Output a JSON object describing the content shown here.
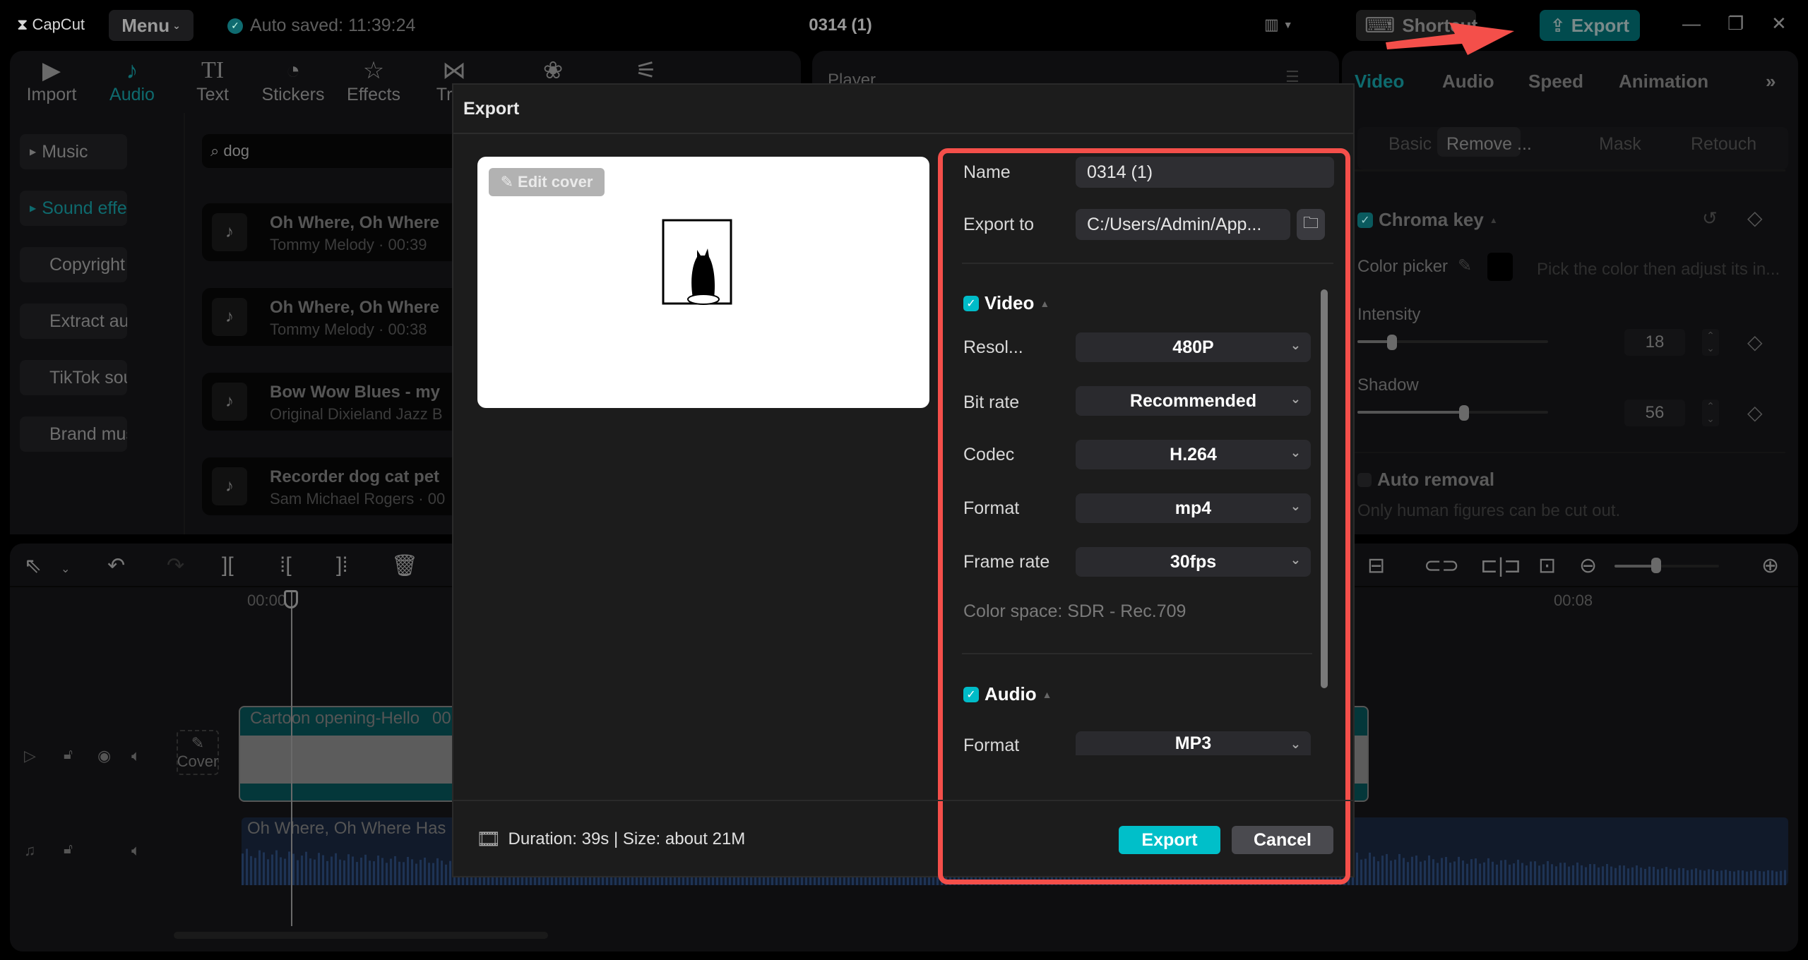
{
  "app": {
    "logo": "CapCut",
    "menu_label": "Menu",
    "autosave": "Auto saved: 11:39:24",
    "title": "0314 (1)",
    "shortcut_label": "Shortcut",
    "export_label": "Export"
  },
  "media_toolbar": [
    {
      "label": "Import",
      "icon": "import-icon"
    },
    {
      "label": "Audio",
      "icon": "audio-icon",
      "active": true
    },
    {
      "label": "Text",
      "icon": "text-icon"
    },
    {
      "label": "Stickers",
      "icon": "stickers-icon"
    },
    {
      "label": "Effects",
      "icon": "effects-icon"
    },
    {
      "label": "Tran",
      "icon": "transitions-icon"
    },
    {
      "label": "",
      "icon": "filters-icon"
    },
    {
      "label": "",
      "icon": "adjustment-icon"
    }
  ],
  "audio_sidebar": [
    {
      "label": "Music"
    },
    {
      "label": "Sound effe...",
      "active": true
    },
    {
      "label": "Copyright"
    },
    {
      "label": "Extract audio"
    },
    {
      "label": "TikTok soun..."
    },
    {
      "label": "Brand music"
    }
  ],
  "search": {
    "value": "dog"
  },
  "audio_results": [
    {
      "title": "Oh Where, Oh Where",
      "subtitle": "Tommy Melody · 00:39"
    },
    {
      "title": "Oh Where, Oh Where",
      "subtitle": "Tommy Melody · 00:38"
    },
    {
      "title": "Bow Wow Blues  - my",
      "subtitle": "Original Dixieland Jazz B"
    },
    {
      "title": "Recorder dog cat pet",
      "subtitle": "Sam Michael Rogers · 00"
    }
  ],
  "player": {
    "title": "Player"
  },
  "right_panel": {
    "tabs": [
      "Video",
      "Audio",
      "Speed",
      "Animation"
    ],
    "subtabs": [
      "Basic",
      "Remove ...",
      "Mask",
      "Retouch"
    ],
    "chroma_key": "Chroma key",
    "color_picker": "Color picker",
    "color_hint": "Pick the color then adjust its in...",
    "intensity_label": "Intensity",
    "intensity_value": "18",
    "intensity_fraction": 0.18,
    "shadow_label": "Shadow",
    "shadow_value": "56",
    "shadow_fraction": 0.56,
    "auto_removal": "Auto removal",
    "auto_removal_hint": "Only human figures can be cut out."
  },
  "timeline": {
    "ruler_start": "00:00",
    "ruler_mark": "00:08",
    "video_clip_label": "Cartoon opening-Hello",
    "video_clip_time": "00",
    "cover_label": "Cover",
    "audio_clip_label": "Oh Where, Oh Where Has M",
    "zoom_fraction": 0.4
  },
  "export_dialog": {
    "title": "Export",
    "edit_cover": "Edit cover",
    "name_label": "Name",
    "name_value": "0314 (1)",
    "export_to_label": "Export to",
    "export_to_value": "C:/Users/Admin/App...",
    "video_section": "Video",
    "video_checked": true,
    "resolution_label": "Resol...",
    "resolution_value": "480P",
    "bitrate_label": "Bit rate",
    "bitrate_value": "Recommended",
    "codec_label": "Codec",
    "codec_value": "H.264",
    "format_label": "Format",
    "format_value": "mp4",
    "framerate_label": "Frame rate",
    "framerate_value": "30fps",
    "color_space": "Color space: SDR - Rec.709",
    "audio_section": "Audio",
    "audio_checked": true,
    "audio_format_label": "Format",
    "audio_format_value": "MP3",
    "duration_info": "Duration: 39s | Size: about 21M",
    "export_button": "Export",
    "cancel_button": "Cancel"
  },
  "colors": {
    "accent": "#00bfc9",
    "annotation": "#f44f4a",
    "dim_accent": "#0e6a6e"
  }
}
